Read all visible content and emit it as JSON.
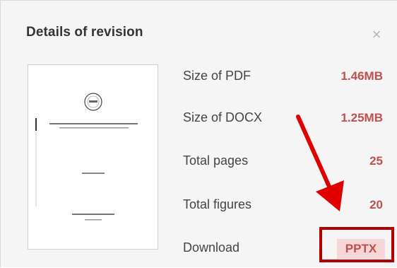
{
  "dialog": {
    "title": "Details of revision",
    "close_glyph": "×"
  },
  "details": {
    "rows": [
      {
        "label": "Size of PDF",
        "value": "1.46MB"
      },
      {
        "label": "Size of DOCX",
        "value": "1.25MB"
      },
      {
        "label": "Total pages",
        "value": "25"
      },
      {
        "label": "Total figures",
        "value": "20"
      },
      {
        "label": "Download",
        "value": "PPTX"
      }
    ]
  },
  "colors": {
    "accent_value": "#c0504d",
    "highlight_box": "#b00000",
    "annotation_arrow": "#e00000",
    "button_bg": "#f6d6d6"
  },
  "icons": {
    "close": "close-icon",
    "arrow": "annotation-arrow-icon"
  }
}
